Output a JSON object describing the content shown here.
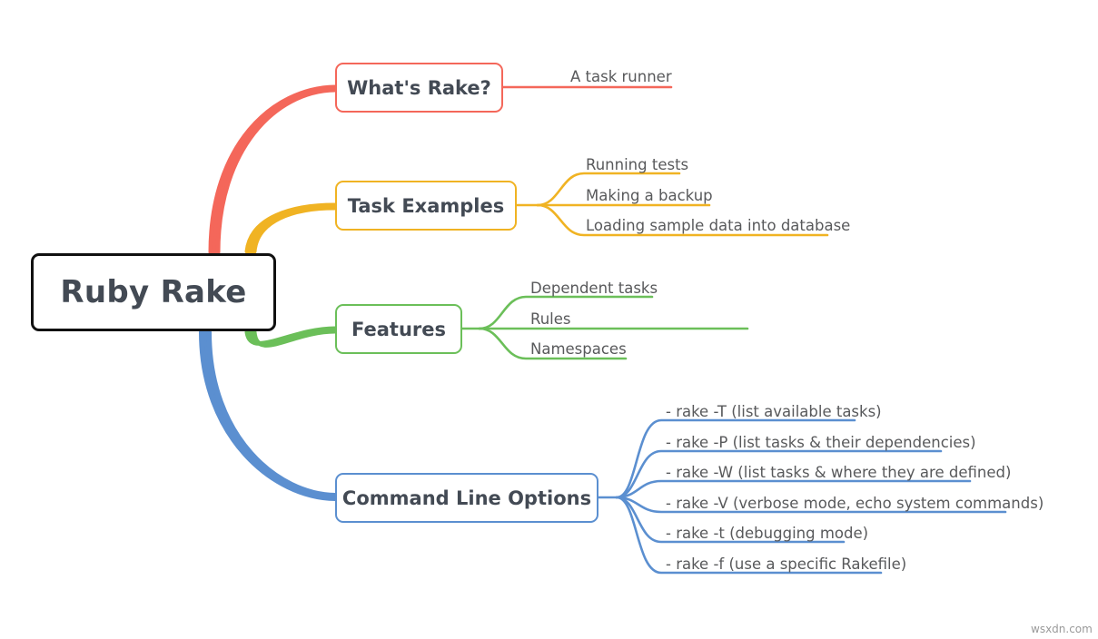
{
  "meta": {
    "watermark": "wsxdn.com",
    "colors": {
      "root_border": "#111111",
      "text_dark": "#434a54",
      "leaf_text": "#58595b",
      "red": "#F4675A",
      "yellow": "#F0B323",
      "green": "#6BBF59",
      "blue": "#5B8FD0",
      "background": "#FFFFFF"
    }
  },
  "mindmap": {
    "root": {
      "label": "Ruby Rake"
    },
    "branches": [
      {
        "id": "whats-rake",
        "label": "What's Rake?",
        "color": "#F4675A",
        "children": [
          {
            "label": "A task runner"
          }
        ]
      },
      {
        "id": "task-examples",
        "label": "Task Examples",
        "color": "#F0B323",
        "children": [
          {
            "label": "Running tests"
          },
          {
            "label": "Making a backup"
          },
          {
            "label": "Loading sample data into database"
          }
        ]
      },
      {
        "id": "features",
        "label": "Features",
        "color": "#6BBF59",
        "children": [
          {
            "label": "Dependent tasks"
          },
          {
            "label": "Rules"
          },
          {
            "label": "Namespaces"
          }
        ]
      },
      {
        "id": "command-line-options",
        "label": "Command Line Options",
        "color": "#5B8FD0",
        "children": [
          {
            "label": "- rake -T (list available tasks)"
          },
          {
            "label": "- rake -P (list tasks & their dependencies)"
          },
          {
            "label": "- rake -W (list tasks & where they are defined)"
          },
          {
            "label": "- rake -V (verbose mode, echo system commands)"
          },
          {
            "label": "- rake -t (debugging mode)"
          },
          {
            "label": "- rake -f (use a specific Rakefile)"
          }
        ]
      }
    ]
  }
}
